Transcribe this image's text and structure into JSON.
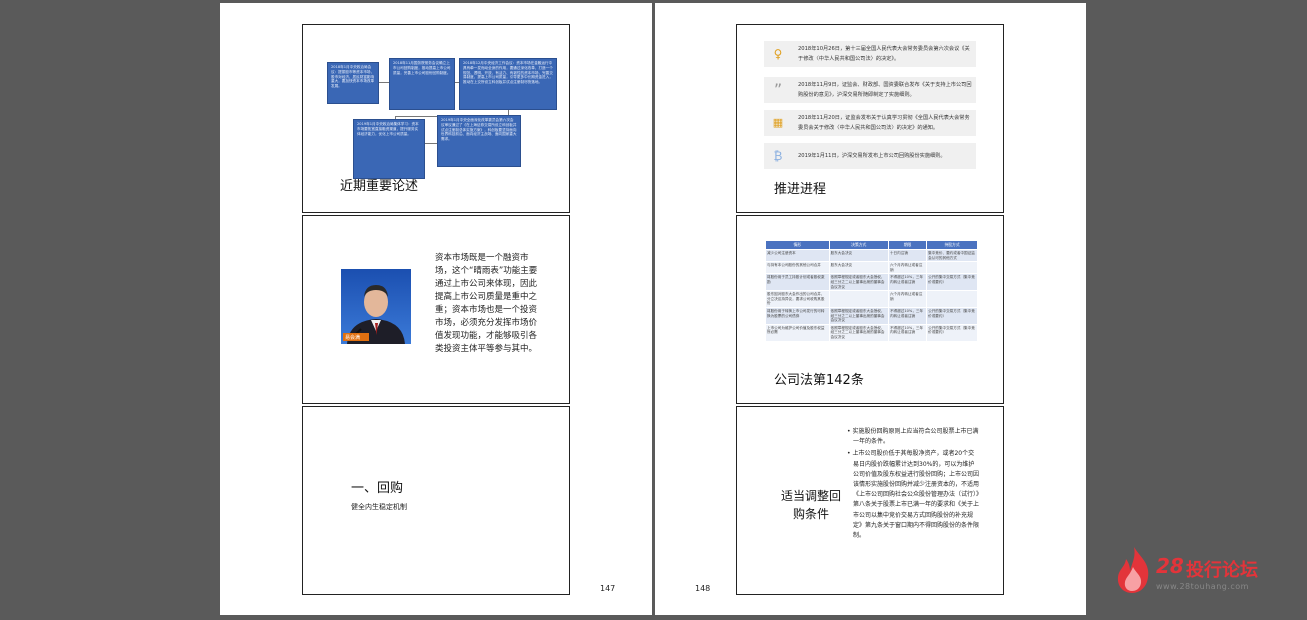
{
  "left_page": {
    "page_number": "147",
    "slide1": {
      "caption": "近期重要论述",
      "flow_boxes": [
        "2018年1月中央政治局会议：提振股市等资本市场，股市对经济、居民财富影响重大，要加快资本市场改革发展。",
        "2018年11月国务院常务会议确立上市公司回购制度，推动提高上市公司质量，完善上市公司股份回购制度。",
        "2018年12月中央经济工作会议：资本市场在金融运行中具有牵一发而动全身的作用，要通过深化改革，打造一个规范、透明、开放、有活力、有韧性的资本市场，完善交易制度，提高上市公司质量，引导更多中长期资金进入，推动在上交所设立科创板并试点注册制尽快落地。",
        "2019年1月中央政治局集体学习：资本市场要拓宽直接融资渠道，提升服务实体经济能力，优化上市公司质量。",
        "2019年1月中央全面深化改革委员会第六次会议审议通过了《在上海证券交易所设立科创板并试点注册制总体实施方案》，科创板要坚持面向世界科技前沿、面向经济主战场、面向国家重大需求。"
      ]
    },
    "slide2": {
      "photo_name_tag": "易会满",
      "text": "资本市场既是一个融资市场，这个“晴雨表”功能主要通过上市公司来体现，因此提高上市公司质量是重中之重；资本市场也是一个投资市场，必须充分发挥市场价值发现功能，才能够吸引各类投资主体平等参与其中。"
    },
    "slide3": {
      "title": "一、回购",
      "subtitle": "健全内生稳定机制"
    }
  },
  "right_page": {
    "page_number": "148",
    "slide1": {
      "caption": "推进进程",
      "timeline": [
        {
          "icon": "lightbulb-icon",
          "text": "2018年10月26日，第十三届全国人民代表大会常务委员会第六次会议《关于修改〈中华人民共和国公司法〉的决定》。"
        },
        {
          "icon": "quote-icon",
          "text": "2018年11月9日，证监会、财政部、国资委联合发布《关于支持上市公司回购股份的意见》，沪深交易所随即制定了实施细则。"
        },
        {
          "icon": "bank-icon",
          "text": "2018年11月20日，证监会发布关于认真学习贯彻《全国人民代表大会常务委员会关于修改〈中华人民共和国公司法〉的决定》的通知。"
        },
        {
          "icon": "bitcoin-icon",
          "text": "2019年1月11日，沪深交易所发布上市公司回购股份实施细则。"
        }
      ]
    },
    "slide2": {
      "caption": "公司法第142条",
      "table": {
        "headers": [
          "情形",
          "决策方式",
          "期限",
          "持股方式"
        ],
        "rows": [
          [
            "减少公司注册资本",
            "股东大会决议",
            "十日内注销",
            "集中竞价、要约或者中国证监会认可的其他方式"
          ],
          [
            "与持有本公司股份的其他公司合并",
            "股东大会决议",
            "六个月内转让或者注销",
            ""
          ],
          [
            "将股份用于员工持股计划或者股权激励",
            "依照章程规定或者股东大会授权，经三分之二以上董事出席的董事会会议决议",
            "不得超过10%，三年内转让或者注销",
            "公开的集中交易方式（集中竞价或要约）"
          ],
          [
            "股东因对股东大会作出的公司合并、分立决议持异议，要求公司收购其股份",
            "",
            "六个月内转让或者注销",
            ""
          ],
          [
            "将股份用于转换上市公司发行的可转换为股票的公司债券",
            "依照章程规定或者股东大会授权，经三分之二以上董事出席的董事会会议决议",
            "不得超过10%，三年内转让或者注销",
            "公开的集中交易方式（集中竞价或要约）"
          ],
          [
            "上市公司为维护公司价值及股东权益所必需",
            "依照章程规定或者股东大会授权，经三分之二以上董事出席的董事会会议决议",
            "不得超过10%，三年内转让或者注销",
            "公开的集中交易方式（集中竞价或要约）"
          ]
        ]
      }
    },
    "slide3": {
      "caption_line1": "适当调整回",
      "caption_line2": "购条件",
      "bullets": [
        "实施股份回购原则上应当符合公司股票上市已满一年的条件。",
        "上市公司股价低于其每股净资产，或者20个交易日内股价跌幅累计达到30%的，可以为维护公司价值及股东权益进行股份回购；上市公司因该情形实施股份回购并减少注册资本的，不适用《上市公司回购社会公众股份管理办法（试行）》第八条关于股票上市已满一年的要求和《关于上市公司以集中竞价交易方式回购股份的补充规定》第九条关于窗口期内不得回购股份的条件限制。"
      ]
    }
  },
  "watermark": {
    "number": "28",
    "name": "投行论坛",
    "url": "www.28touhang.com",
    "color": "#e3343a"
  }
}
